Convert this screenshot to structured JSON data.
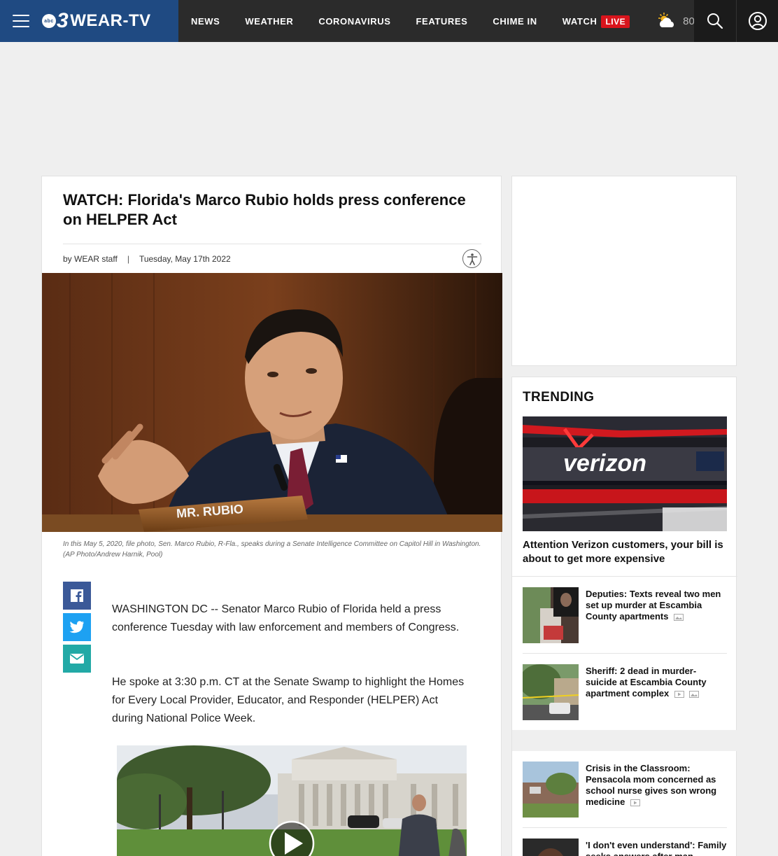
{
  "header": {
    "logo_text": "WEAR-TV",
    "logo_number": "3",
    "logo_network": "abc",
    "nav": [
      "NEWS",
      "WEATHER",
      "CORONAVIRUS",
      "FEATURES",
      "CHIME IN",
      "WATCH"
    ],
    "live_label": "LIVE",
    "temperature": "80",
    "degree": "°"
  },
  "article": {
    "headline": "WATCH: Florida's Marco Rubio holds press conference on HELPER Act",
    "byline": "by WEAR staff",
    "byline_sep": "|",
    "date": "Tuesday, May 17th 2022",
    "nameplate": "MR. RUBIO",
    "caption": "In this May 5, 2020, file photo, Sen. Marco Rubio, R-Fla., speaks during a Senate Intelligence Committee on Capitol Hill in Washington. (AP Photo/Andrew Harnik, Pool)",
    "paragraphs": [
      "WASHINGTON DC -- Senator Marco Rubio of Florida held a press conference Tuesday with law enforcement and members of Congress.",
      "He spoke at 3:30 p.m. CT at the Senate Swamp to highlight the Homes for Every Local Provider, Educator, and Responder (HELPER) Act during National Police Week."
    ]
  },
  "trending": {
    "title": "TRENDING",
    "hero_brand": "verizon",
    "hero_title": "Attention Verizon customers, your bill is about to get more expensive",
    "items": [
      {
        "title": "Deputies: Texts reveal two men set up murder at Escambia County apartments"
      },
      {
        "title": "Sheriff: 2 dead in murder-suicide at Escambia County apartment complex"
      },
      {
        "title": "Crisis in the Classroom: Pensacola mom concerned as school nurse gives son wrong medicine"
      },
      {
        "title": "'I don't even understand': Family seeks answers after man"
      }
    ]
  },
  "colors": {
    "brand_blue": "#1f4a82",
    "topbar": "#2b2b2b",
    "live_red": "#d9141c",
    "facebook": "#3b5998",
    "twitter": "#1da1f2",
    "email": "#22a9a6"
  },
  "icons": [
    "menu-icon",
    "sun-cloud-icon",
    "search-icon",
    "user-icon",
    "accessibility-icon",
    "facebook-icon",
    "twitter-icon",
    "email-icon",
    "play-icon",
    "gallery-icon",
    "video-icon"
  ]
}
